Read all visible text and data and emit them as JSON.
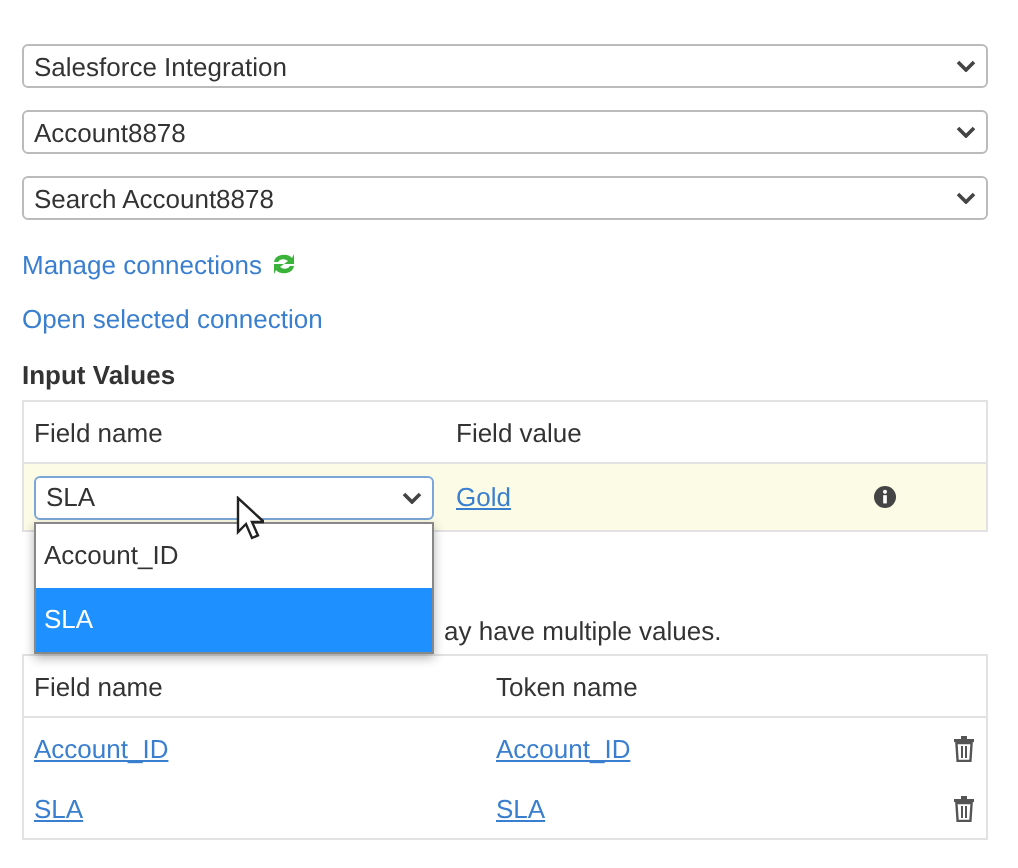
{
  "selects": [
    {
      "value": "Salesforce Integration"
    },
    {
      "value": "Account8878"
    },
    {
      "value": "Search Account8878"
    }
  ],
  "links": [
    {
      "label": "Manage connections",
      "kind": "refresh"
    },
    {
      "label": "Open selected connection",
      "kind": "plain"
    }
  ],
  "input_values": {
    "heading": "Input Values",
    "columns": [
      "Field name",
      "Field value"
    ],
    "row": {
      "field": "SLA",
      "value": "Gold",
      "highlighted": true
    },
    "dropdown": {
      "options": [
        {
          "label": "Account_ID",
          "selected": false
        },
        {
          "label": "SLA",
          "selected": true
        }
      ]
    }
  },
  "output": {
    "description_end": "ay have multiple values.",
    "columns": [
      "Field name",
      "Token name"
    ],
    "rows": [
      {
        "field": "Account_ID",
        "token": "Account_ID"
      },
      {
        "field": "SLA",
        "token": "SLA"
      }
    ]
  }
}
